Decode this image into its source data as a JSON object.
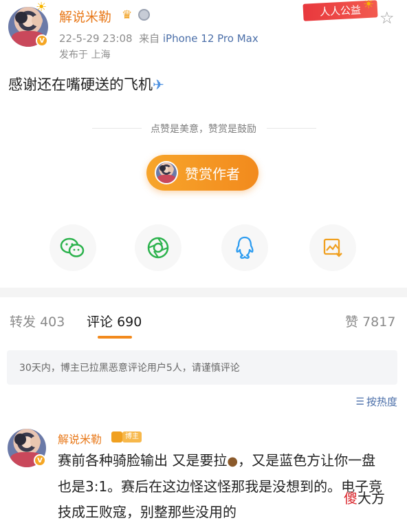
{
  "post": {
    "author": "解说米勒",
    "timestamp": "22-5-29 23:08",
    "source_prefix": "来自",
    "device": "iPhone 12 Pro Max",
    "location": "发布于 上海",
    "gongyi_badge": "人人公益",
    "text": "感谢还在嘴硬送的飞机",
    "verified_mark": "V"
  },
  "reward": {
    "hint": "点赞是美意，赞赏是鼓励",
    "button_label": "赞赏作者"
  },
  "share": {
    "items": [
      "wechat-icon",
      "moments-icon",
      "qq-icon",
      "save-image-icon"
    ]
  },
  "tabs": {
    "repost_label": "转发",
    "repost_count": "403",
    "comment_label": "评论",
    "comment_count": "690",
    "like_label": "赞",
    "like_count": "7817"
  },
  "notice": {
    "text": "30天内，博主已拉黑恶意评论用户5人，请谨慎评论"
  },
  "sort": {
    "label": "按热度"
  },
  "comment": {
    "author": "解说米勒",
    "blogger_badge": "博主",
    "text_part1": "赛前各种骑脸输出 又是要拉",
    "text_part2": "，又是蓝色方让你一盘也是3:1。赛后在这边怪这怪那我是没想到的。电子竞技成王败寇，别整那些没用的"
  },
  "watermark": {
    "accent": "傻",
    "rest": "大方"
  },
  "colors": {
    "accent_orange": "#f28a1d",
    "username_orange": "#e8791a",
    "link_blue": "#4a6ea8",
    "gongyi_red": "#e8383d"
  }
}
